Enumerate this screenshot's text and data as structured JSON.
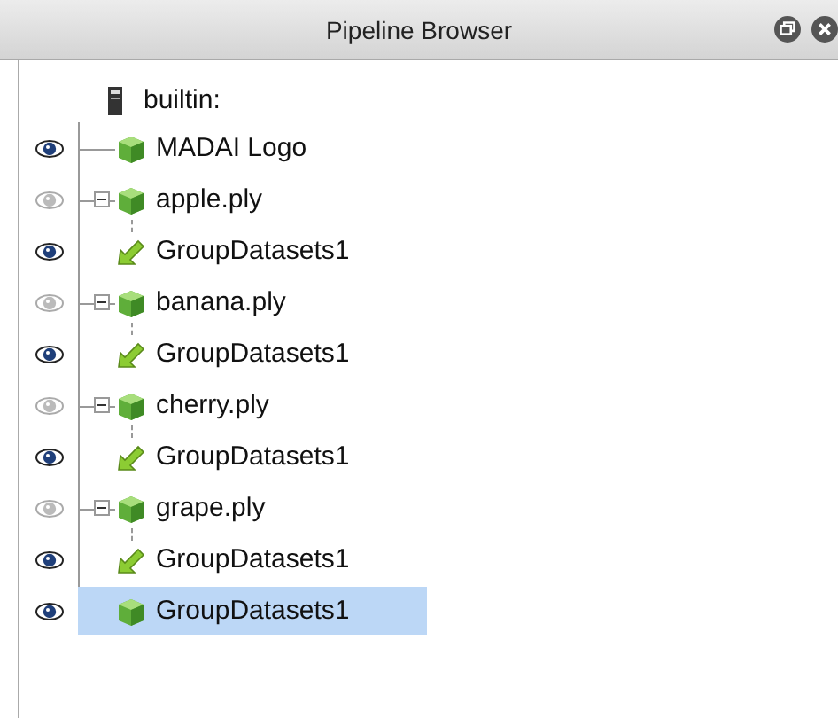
{
  "title_bar": {
    "title": "Pipeline Browser"
  },
  "tree": {
    "label": "builtin:",
    "kind": "server",
    "children": [
      {
        "label": "MADAI Logo",
        "kind": "source",
        "visible": true,
        "selected": false
      },
      {
        "label": "apple.ply",
        "kind": "source",
        "visible": false,
        "selected": false,
        "expanded": true,
        "children": [
          {
            "label": "GroupDatasets1",
            "kind": "filter",
            "visible": true,
            "selected": false
          }
        ]
      },
      {
        "label": "banana.ply",
        "kind": "source",
        "visible": false,
        "selected": false,
        "expanded": true,
        "children": [
          {
            "label": "GroupDatasets1",
            "kind": "filter",
            "visible": true,
            "selected": false
          }
        ]
      },
      {
        "label": "cherry.ply",
        "kind": "source",
        "visible": false,
        "selected": false,
        "expanded": true,
        "children": [
          {
            "label": "GroupDatasets1",
            "kind": "filter",
            "visible": true,
            "selected": false
          }
        ]
      },
      {
        "label": "grape.ply",
        "kind": "source",
        "visible": false,
        "selected": false,
        "expanded": true,
        "children": [
          {
            "label": "GroupDatasets1",
            "kind": "filter",
            "visible": true,
            "selected": false
          }
        ]
      },
      {
        "label": "GroupDatasets1",
        "kind": "source",
        "visible": true,
        "selected": true
      }
    ]
  }
}
